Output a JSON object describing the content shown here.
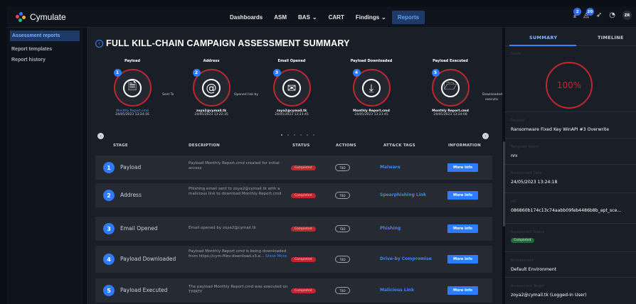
{
  "app": {
    "name": "Cymulate",
    "logo_colors": [
      "#ff3b6b",
      "#2f7bff",
      "#ffb020",
      "#20c080"
    ]
  },
  "nav": {
    "items": [
      {
        "label": "Dashboards"
      },
      {
        "label": "ASM"
      },
      {
        "label": "BAS",
        "caret": "⌄"
      },
      {
        "label": "CART"
      },
      {
        "label": "Findings",
        "caret": "⌄"
      },
      {
        "label": "Reports",
        "active": true
      }
    ]
  },
  "topbar": {
    "badge1": "2",
    "badge2": "20",
    "avatar": "ZR",
    "icons": [
      "download-icon",
      "bell-icon",
      "rocket-icon",
      "help-icon"
    ]
  },
  "sidebar": {
    "items": [
      {
        "label": "Assessment reports",
        "active": true
      },
      {
        "label": "Report templates"
      },
      {
        "label": "Report history"
      }
    ]
  },
  "main": {
    "title": "FULL KILL-CHAIN CAMPAIGN ASSESSMENT SUMMARY",
    "steps": [
      {
        "num": "1",
        "name": "Payload",
        "icon": "document-icon",
        "glyph": "🗎",
        "sub": "Monthly Report.cmd",
        "date": "24/05/2023 13:24:16",
        "link": true
      },
      {
        "num": "2",
        "name": "Address",
        "icon": "at-icon",
        "glyph": "@",
        "sub": "zoya2@cymail.tk",
        "date": "24/05/2023 13:22:35"
      },
      {
        "num": "3",
        "name": "Email Opened",
        "icon": "envelope-open-icon",
        "glyph": "✉",
        "sub": "zoya2@cymail.tk",
        "date": "24/05/2023 13:23:45"
      },
      {
        "num": "4",
        "name": "Payload Downloaded",
        "icon": "download-icon",
        "glyph": "⤓",
        "sub": "Monthly Report.cmd",
        "date": "24/05/2023 13:23:45"
      },
      {
        "num": "5",
        "name": "Payload Executed",
        "icon": "file-run-icon",
        "glyph": "🗁",
        "sub": "Monthly Report.cmd",
        "date": "24/05/2023 13:24:08"
      }
    ],
    "connectors": {
      "c1": "Sent To",
      "c2": "Opened link by",
      "c5": "Downloaded",
      "c5b": "executa"
    },
    "columns": {
      "stage": "STAGE",
      "description": "DESCRIPTION",
      "status": "STATUS",
      "actions": "ACTIONS",
      "tags": "ATT&CK TAGS",
      "info": "INFORMATION"
    },
    "rows": [
      {
        "num": "1",
        "stage": "Payload",
        "desc": "Payload Monthly Report.cmd created for initial access",
        "more": "",
        "status": "Completed",
        "action": "TBD",
        "tag": "Malware",
        "info": "More Info"
      },
      {
        "num": "2",
        "stage": "Address",
        "desc": "Phishing email sent to zoya2@cymail.tk with a malicious link to download Monthly Report.cmd",
        "more": "",
        "status": "Completed",
        "action": "TBD",
        "tag": "Spearphishing Link",
        "info": "More Info"
      },
      {
        "num": "3",
        "stage": "Email Opened",
        "desc": "Email opened by zoya2@cymail.tk",
        "more": "",
        "status": "Completed",
        "action": "TBD",
        "tag": "Phishing",
        "info": "More Info"
      },
      {
        "num": "4",
        "stage": "Payload Downloaded",
        "desc": "Payload Monthly Report.cmd is being downloaded from https://cym-files-download.s3.e...",
        "more": "Show More",
        "status": "Completed",
        "action": "TBD",
        "tag": "Drive-by Compromise",
        "info": "More Info"
      },
      {
        "num": "5",
        "stage": "Payload Executed",
        "desc": "The payload Monthly Report.cmd was executed on THIRTY",
        "more": "",
        "status": "Completed",
        "action": "TBD",
        "tag": "Malicious Link",
        "info": "More Info"
      }
    ]
  },
  "panel": {
    "tabs": {
      "summary": "SUMMARY",
      "timeline": "TIMELINE"
    },
    "score_label": "Score",
    "score": "100%",
    "fields": [
      {
        "label": "Payload",
        "value": "Ransomware Fixed Key WinAPI #3 Overwrite"
      },
      {
        "label": "Template Name",
        "value": "nnı"
      },
      {
        "label": "Assessment Date",
        "value": "24/05/2023 13:24:18"
      },
      {
        "label": "IOC",
        "value": "086860b174c13c74aabb09feb4486b8b_apt_sce..."
      },
      {
        "label": "Assessment Status",
        "badge": "Completed"
      },
      {
        "label": "Environment",
        "value": "Default Environment"
      },
      {
        "label": "Assessment Target",
        "value": "zoya2@cymail.tk (Logged-In User)"
      }
    ]
  }
}
